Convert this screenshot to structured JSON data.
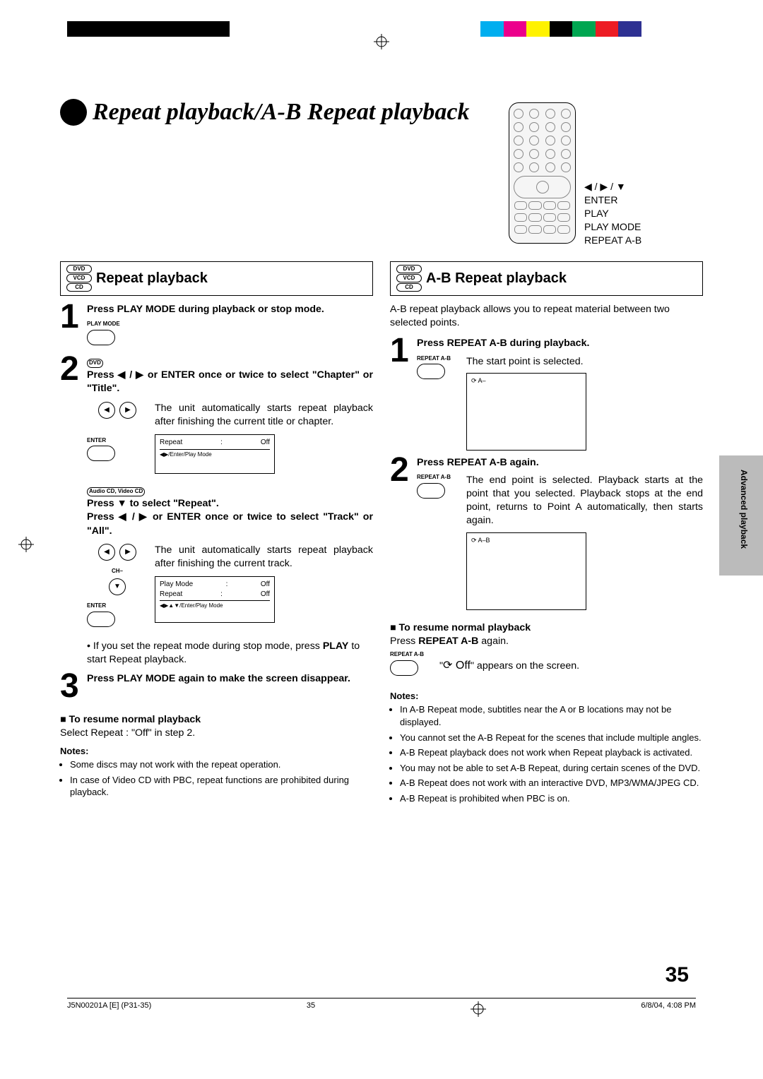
{
  "title": "Repeat playback/A-B Repeat playback",
  "remote_labels": {
    "l1": "◀ / ▶ / ▼",
    "l2": "ENTER",
    "l3": "PLAY",
    "l4": "PLAY MODE",
    "l5": "REPEAT A-B"
  },
  "disc": {
    "dvd": "DVD",
    "vcd": "VCD",
    "cd": "CD"
  },
  "left": {
    "heading": "Repeat playback",
    "s1": {
      "instr": "Press PLAY MODE during playback or stop mode.",
      "cap": "PLAY MODE"
    },
    "s2": {
      "dvd_label": "DVD",
      "instr": "Press ◀ / ▶ or ENTER once or twice to select \"Chapter\" or \"Title\".",
      "desc": "The unit automatically starts repeat playback after finishing the current title or chapter.",
      "enter": "ENTER",
      "screen_r": "Repeat",
      "screen_v": "Off",
      "screen_help": "◀▶/Enter/Play Mode"
    },
    "s2b": {
      "head1": "Audio CD, Video CD",
      "head2": "Press ▼ to select \"Repeat\".",
      "head3": "Press ◀ / ▶ or ENTER once or twice to select \"Track\" or \"All\".",
      "desc": "The unit automatically starts repeat playback after finishing the current track.",
      "ch": "CH–",
      "enter": "ENTER",
      "scr_pm": "Play Mode",
      "scr_r": "Repeat",
      "scr_off": "Off",
      "scr_help": "◀▶▲▼/Enter/Play Mode"
    },
    "note_between_pre": "• If you set the repeat mode during stop mode, press ",
    "note_between_bold": "PLAY",
    "note_between_post": " to start Repeat playback.",
    "s3": "Press PLAY MODE again to make the screen disappear.",
    "resume_h": "■ To resume normal playback",
    "resume_t": "Select Repeat : \"Off\" in step 2.",
    "notes_h": "Notes:",
    "n1": "Some discs may not work with the repeat operation.",
    "n2": "In case of Video CD with PBC, repeat functions are prohibited during playback."
  },
  "right": {
    "heading": "A-B Repeat playback",
    "intro": "A-B repeat playback allows you to repeat material between two selected points.",
    "s1": {
      "instr": "Press REPEAT A-B during playback.",
      "desc": "The start point is selected.",
      "cap": "REPEAT A-B",
      "tag": "⟳ A–"
    },
    "s2": {
      "instr": "Press REPEAT A-B again.",
      "cap": "REPEAT A-B",
      "desc": "The end point is selected. Playback starts at the point that you selected. Playback stops at the end point, returns to Point A automatically, then starts again.",
      "tag": "⟳ A–B"
    },
    "resume_h": "■ To resume normal playback",
    "resume_t_pre": "Press ",
    "resume_t_bold": "REPEAT A-B",
    "resume_t_post": " again.",
    "cap": "REPEAT A-B",
    "off_pre": "\"",
    "off_mid": "⟳ Off",
    "off_post": "\" appears on the screen.",
    "notes_h": "Notes:",
    "n1": "In A-B Repeat mode, subtitles near the A or B locations may not be displayed.",
    "n2": "You cannot set the A-B Repeat for the scenes that include multiple angles.",
    "n3": "A-B Repeat playback does not work when Repeat playback is activated.",
    "n4": "You may not be able to set A-B Repeat, during certain scenes of the DVD.",
    "n5": "A-B Repeat does not work with an interactive DVD, MP3/WMA/JPEG CD.",
    "n6": "A-B Repeat is prohibited when PBC is on."
  },
  "side_tab": "Advanced playback",
  "page_number": "35",
  "footer": {
    "doc": "J5N00201A [E] (P31-35)",
    "pg": "35",
    "date": "6/8/04, 4:08 PM"
  }
}
